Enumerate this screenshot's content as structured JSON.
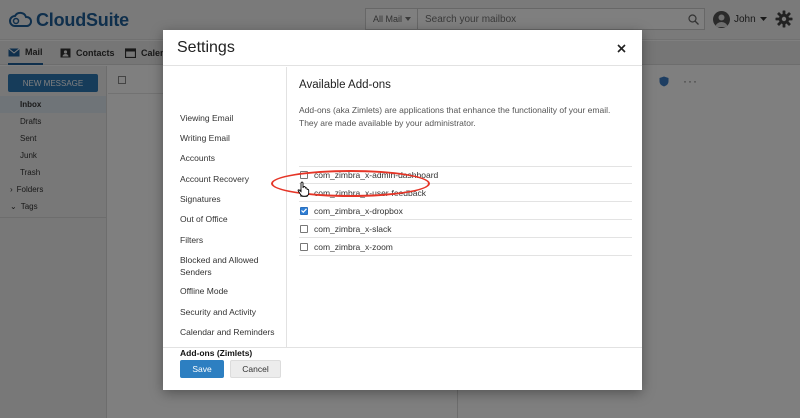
{
  "app": {
    "brand": "CloudSuite",
    "search_scope": "All Mail",
    "search_placeholder": "Search your mailbox",
    "user_name": "John",
    "nav": {
      "mail": "Mail",
      "contacts": "Contacts",
      "calendar": "Calen"
    },
    "new_message": "NEW MESSAGE",
    "folders": [
      "Inbox",
      "Drafts",
      "Sent",
      "Junk",
      "Trash"
    ],
    "groups": [
      "Folders",
      "Tags"
    ]
  },
  "modal": {
    "title": "Settings",
    "nav_items": [
      "Viewing Email",
      "Writing Email",
      "Accounts",
      "Account Recovery",
      "Signatures",
      "Out of Office",
      "Filters",
      "Blocked and Allowed Senders",
      "Offline Mode",
      "Security and Activity",
      "Calendar and Reminders",
      "Add-ons (Zimlets)"
    ],
    "selected_nav": "Add-ons (Zimlets)",
    "content_title": "Available Add-ons",
    "content_description": "Add-ons (aka Zimlets) are applications that enhance the functionality of your email. They are made available by your administrator.",
    "addons": [
      {
        "name": "com_zimbra_x-admin-dashboard",
        "checked": false
      },
      {
        "name": "com_zimbra_x-user-feedback",
        "checked": false
      },
      {
        "name": "com_zimbra_x-dropbox",
        "checked": true
      },
      {
        "name": "com_zimbra_x-slack",
        "checked": false
      },
      {
        "name": "com_zimbra_x-zoom",
        "checked": false
      }
    ],
    "save_label": "Save",
    "cancel_label": "Cancel"
  },
  "colors": {
    "brand": "#1f5f99",
    "primary_button": "#2d7fc1",
    "checkbox_checked": "#2f7fd6",
    "highlight_ring": "#e53527"
  }
}
